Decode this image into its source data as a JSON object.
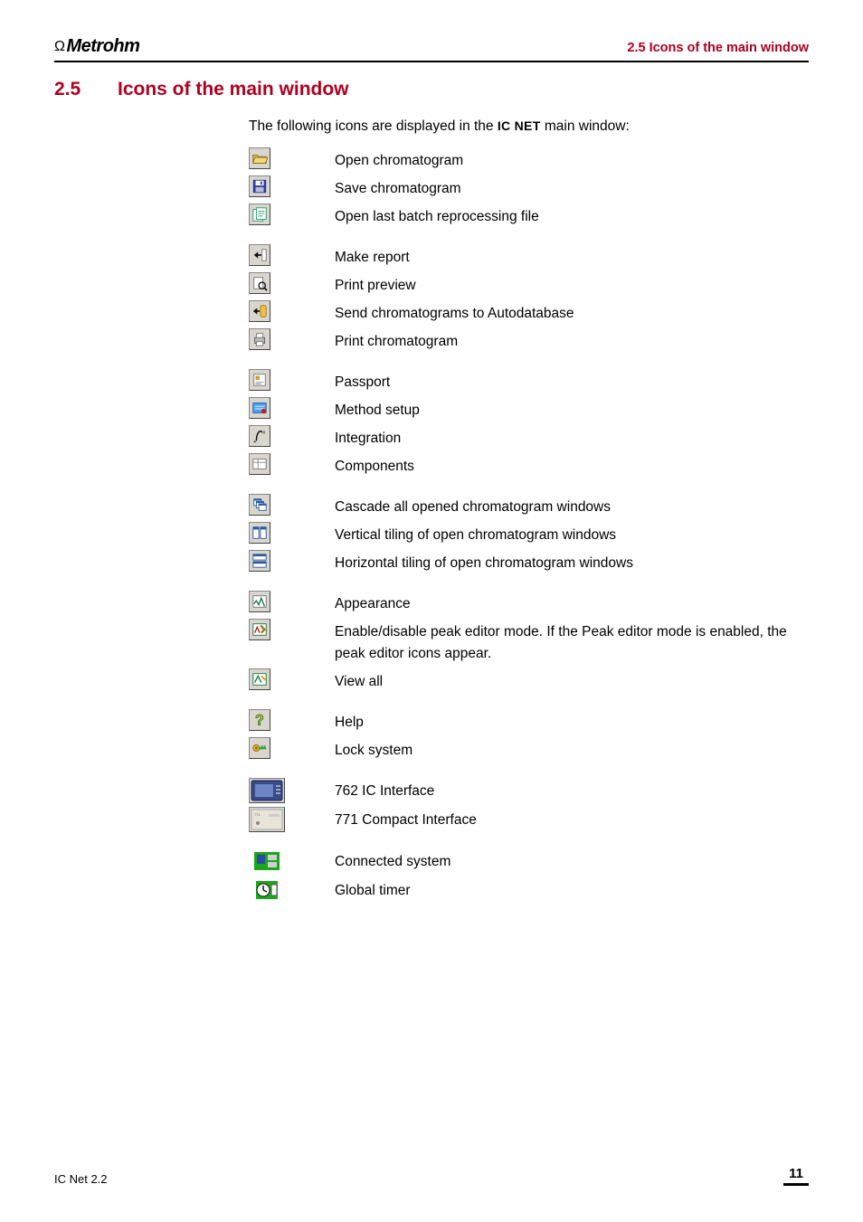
{
  "header": {
    "brand": "Metrohm",
    "section_ref": "2.5  Icons of the main window"
  },
  "title": {
    "number": "2.5",
    "text": "Icons of the main window"
  },
  "intro": {
    "prefix": "The following icons are displayed in the ",
    "strong": "IC NET",
    "suffix": " main window:"
  },
  "groups": [
    {
      "rows": [
        {
          "icon": "open-icon",
          "label": "Open chromatogram"
        },
        {
          "icon": "save-icon",
          "label": "Save chromatogram"
        },
        {
          "icon": "open-batch-icon",
          "label": "Open last batch reprocessing file"
        }
      ]
    },
    {
      "rows": [
        {
          "icon": "make-report-icon",
          "label": "Make report"
        },
        {
          "icon": "print-preview-icon",
          "label": "Print preview"
        },
        {
          "icon": "send-autodb-icon",
          "label": "Send chromatograms to Autodatabase"
        },
        {
          "icon": "print-icon",
          "label": "Print chromatogram"
        }
      ]
    },
    {
      "rows": [
        {
          "icon": "passport-icon",
          "label": "Passport"
        },
        {
          "icon": "method-setup-icon",
          "label": "Method setup"
        },
        {
          "icon": "integration-icon",
          "label": "Integration"
        },
        {
          "icon": "components-icon",
          "label": "Components"
        }
      ]
    },
    {
      "rows": [
        {
          "icon": "cascade-icon",
          "label": "Cascade all opened chromatogram windows"
        },
        {
          "icon": "tile-vertical-icon",
          "label": "Vertical tiling of open chromatogram windows"
        },
        {
          "icon": "tile-horizontal-icon",
          "label": "Horizontal tiling of open chromatogram windows"
        }
      ]
    },
    {
      "rows": [
        {
          "icon": "appearance-icon",
          "label": "Appearance"
        },
        {
          "icon": "peak-editor-icon",
          "label": "Enable/disable peak editor mode. If the Peak editor mode is enabled, the peak editor icons appear."
        },
        {
          "icon": "view-all-icon",
          "label": "View all"
        }
      ]
    },
    {
      "rows": [
        {
          "icon": "help-icon",
          "label": "Help"
        },
        {
          "icon": "lock-icon",
          "label": "Lock system"
        }
      ]
    },
    {
      "rows": [
        {
          "icon": "ic762-icon",
          "label": "762 IC Interface",
          "big": true
        },
        {
          "icon": "ic771-icon",
          "label": "771 Compact Interface",
          "big": true
        }
      ]
    },
    {
      "rows": [
        {
          "icon": "connected-icon",
          "label": "Connected system",
          "plain": true
        },
        {
          "icon": "global-timer-icon",
          "label": "Global timer",
          "plain": true
        }
      ]
    }
  ],
  "footer": {
    "product": "IC Net 2.2",
    "page": "11"
  }
}
